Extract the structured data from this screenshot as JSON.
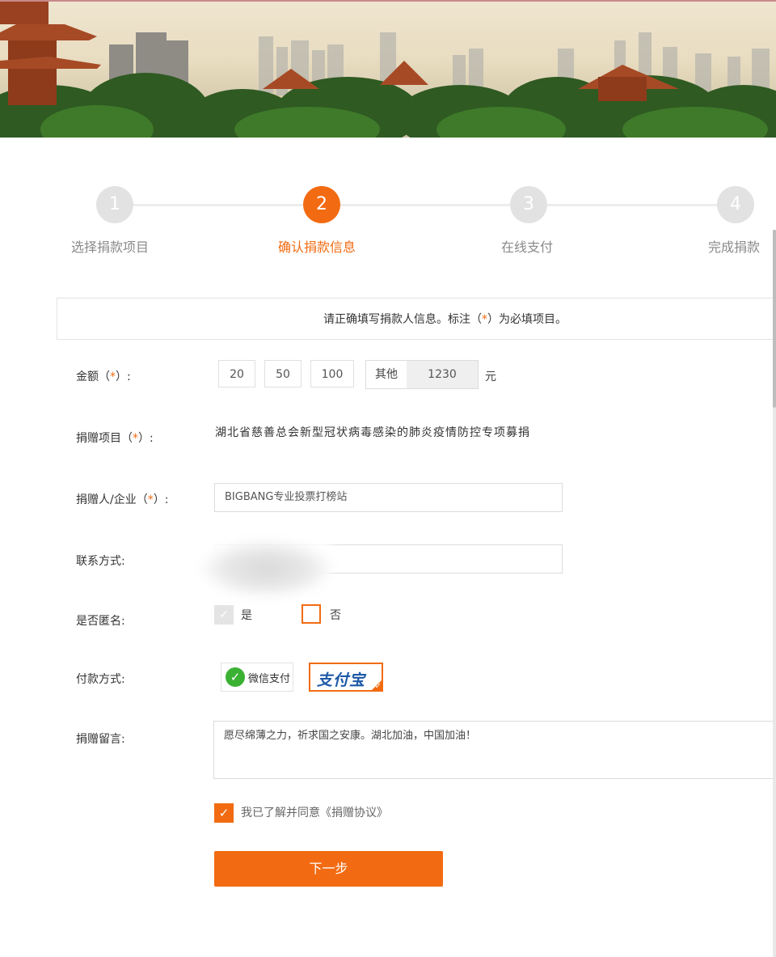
{
  "steps": [
    {
      "number": "1",
      "label": "选择捐款项目",
      "active": false
    },
    {
      "number": "2",
      "label": "确认捐款信息",
      "active": true
    },
    {
      "number": "3",
      "label": "在线支付",
      "active": false
    },
    {
      "number": "4",
      "label": "完成捐款",
      "active": false
    }
  ],
  "notice": {
    "before": "请正确填写捐款人信息。标注（",
    "star": "*",
    "after": "）为必填项目。"
  },
  "form": {
    "amount": {
      "label_text": "金额（",
      "star": "*",
      "label_end": "）:",
      "options": [
        "20",
        "50",
        "100"
      ],
      "other_label": "其他",
      "other_value": "1230",
      "unit": "元"
    },
    "project": {
      "label_text": "捐赠项目（",
      "star": "*",
      "label_end": "）:",
      "value": "湖北省慈善总会新型冠状病毒感染的肺炎疫情防控专项募捐"
    },
    "donor": {
      "label_text": "捐赠人/企业（",
      "star": "*",
      "label_end": "）:",
      "value": "BIGBANG专业投票打榜站"
    },
    "contact": {
      "label": "联系方式:",
      "value": ""
    },
    "anonymous": {
      "label": "是否匿名:",
      "yes_label": "是",
      "no_label": "否",
      "yes_checked": true,
      "no_checked": false
    },
    "payment": {
      "label": "付款方式:",
      "wechat_label": "微信支付",
      "alipay_label": "支付宝",
      "selected": "alipay"
    },
    "message": {
      "label": "捐赠留言:",
      "value": "愿尽绵薄之力，祈求国之安康。湖北加油，中国加油！"
    },
    "agree": {
      "text": "我已了解并同意《捐赠协议》",
      "checked": true
    },
    "next_label": "下一步"
  },
  "colors": {
    "accent": "#f26b12",
    "inactive_step": "#e2e2e2",
    "wechat_green": "#3bb134",
    "alipay_blue": "#1c59a8"
  },
  "icons": {
    "check": "check-icon",
    "wechat": "wechat-pay-logo",
    "alipay": "alipay-logo"
  }
}
